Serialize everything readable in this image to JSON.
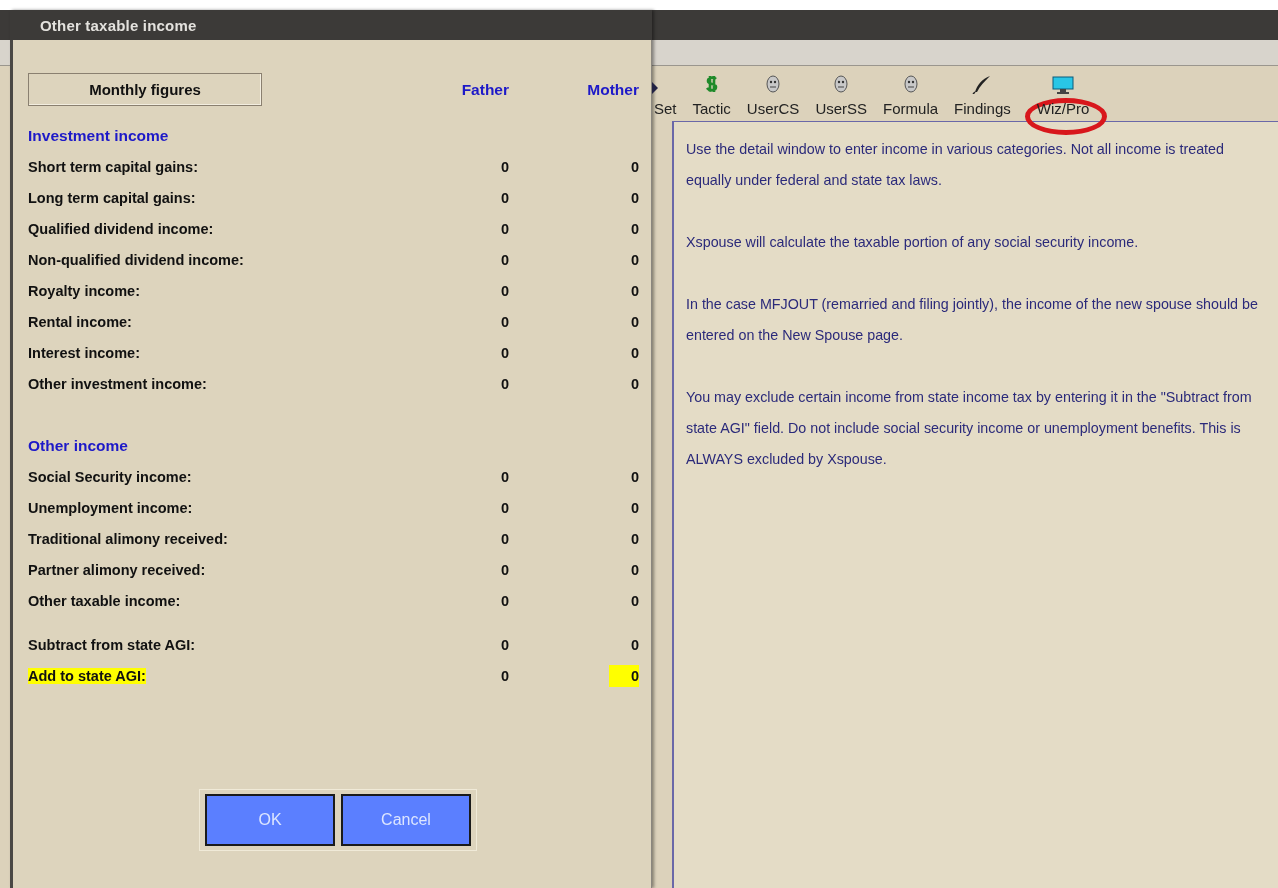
{
  "app": {
    "toolbar": {
      "items": [
        {
          "label": "Set",
          "kind": "arrow",
          "circled": false
        },
        {
          "label": "Tactic",
          "kind": "dollar",
          "circled": false
        },
        {
          "label": "UserCS",
          "kind": "head",
          "circled": false
        },
        {
          "label": "UserSS",
          "kind": "head",
          "circled": false
        },
        {
          "label": "Formula",
          "kind": "head",
          "circled": false
        },
        {
          "label": "Findings",
          "kind": "quill",
          "circled": false
        },
        {
          "label": "Wiz/Pro",
          "kind": "monitor",
          "circled": true
        }
      ]
    },
    "help_panel": {
      "paragraphs": [
        "Use the detail window to enter income in various categories. Not all income is treated equally under federal and state tax laws.",
        "Xspouse will calculate the taxable portion of any social security income.",
        "In the case MFJOUT (remarried and filing jointly), the income of the new spouse should be entered on the New Spouse page.",
        "You may exclude certain income from state income tax by entering it in the \"Subtract from state AGI\" field. Do not include social security income or unemployment benefits. This is ALWAYS excluded by Xspouse."
      ]
    }
  },
  "dialog": {
    "title": "Other taxable income",
    "header": {
      "label": "Monthly figures",
      "columns": [
        "Father",
        "Mother"
      ]
    },
    "sections": [
      {
        "heading": "Investment income",
        "rows": [
          {
            "label": "Short term capital gains:",
            "father": "0",
            "mother": "0",
            "highlighted": false
          },
          {
            "label": "Long term capital gains:",
            "father": "0",
            "mother": "0",
            "highlighted": false
          },
          {
            "label": "Qualified dividend income:",
            "father": "0",
            "mother": "0",
            "highlighted": false
          },
          {
            "label": "Non-qualified dividend income:",
            "father": "0",
            "mother": "0",
            "highlighted": false
          },
          {
            "label": "Royalty income:",
            "father": "0",
            "mother": "0",
            "highlighted": false
          },
          {
            "label": "Rental income:",
            "father": "0",
            "mother": "0",
            "highlighted": false
          },
          {
            "label": "Interest income:",
            "father": "0",
            "mother": "0",
            "highlighted": false
          },
          {
            "label": "Other investment income:",
            "father": "0",
            "mother": "0",
            "highlighted": false
          }
        ]
      },
      {
        "heading": "Other income",
        "rows": [
          {
            "label": "Social Security income:",
            "father": "0",
            "mother": "0",
            "highlighted": false
          },
          {
            "label": "Unemployment income:",
            "father": "0",
            "mother": "0",
            "highlighted": false
          },
          {
            "label": "Traditional alimony received:",
            "father": "0",
            "mother": "0",
            "highlighted": false
          },
          {
            "label": "Partner alimony received:",
            "father": "0",
            "mother": "0",
            "highlighted": false
          },
          {
            "label": "Other taxable income:",
            "father": "0",
            "mother": "0",
            "highlighted": false
          }
        ]
      },
      {
        "rows": [
          {
            "label": "Subtract from state AGI:",
            "father": "0",
            "mother": "0",
            "highlighted": false
          },
          {
            "label": "Add to state AGI:",
            "father": "0",
            "mother": "0",
            "highlighted": true
          }
        ]
      }
    ],
    "buttons": [
      "OK",
      "Cancel"
    ]
  }
}
